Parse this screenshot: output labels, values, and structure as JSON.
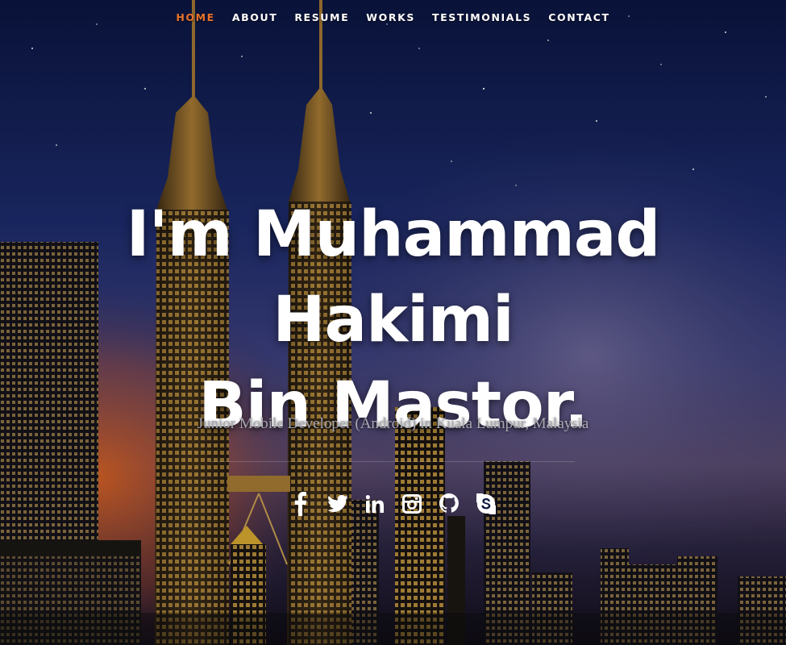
{
  "nav": {
    "items": [
      {
        "label": "HOME",
        "active": true
      },
      {
        "label": "ABOUT",
        "active": false
      },
      {
        "label": "RESUME",
        "active": false
      },
      {
        "label": "WORKS",
        "active": false
      },
      {
        "label": "TESTIMONIALS",
        "active": false
      },
      {
        "label": "CONTACT",
        "active": false
      }
    ],
    "active_color": "#e8732b"
  },
  "hero": {
    "headline_line1": "I'm Muhammad Hakimi",
    "headline_line2": "Bin Mastor.",
    "subtitle": "Junior Mobile Developer (Android) in Kuala Lumpur, Malaysia",
    "social": [
      {
        "icon": "facebook-icon"
      },
      {
        "icon": "twitter-icon"
      },
      {
        "icon": "linkedin-icon"
      },
      {
        "icon": "instagram-icon"
      },
      {
        "icon": "github-icon"
      },
      {
        "icon": "skype-icon"
      }
    ]
  }
}
